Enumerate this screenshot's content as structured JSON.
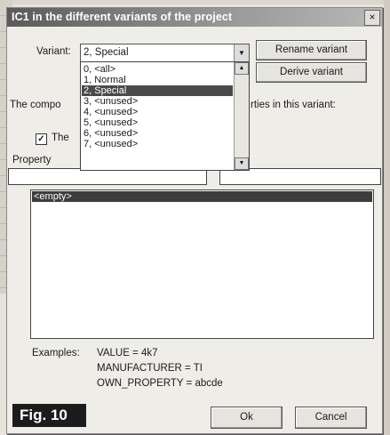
{
  "dialog": {
    "title": "IC1 in the different variants of the project",
    "close_label": "×"
  },
  "variant": {
    "label": "Variant:",
    "selected": "2, Special",
    "options": [
      "0, <all>",
      "1, Normal",
      "2, Special",
      "3, <unused>",
      "4, <unused>",
      "5, <unused>",
      "6, <unused>",
      "7, <unused>"
    ]
  },
  "buttons": {
    "rename": "Rename variant",
    "derive": "Derive variant",
    "ok": "Ok",
    "cancel": "Cancel"
  },
  "components_text_left": "The compo",
  "components_text_right": "rties in this variant:",
  "checkbox": {
    "mark": "✓",
    "label_partial": "The"
  },
  "property_label": "Property",
  "list": {
    "items": [
      "<empty>"
    ]
  },
  "examples": {
    "label": "Examples:",
    "lines": [
      "VALUE = 4k7",
      "MANUFACTURER = TI",
      "OWN_PROPERTY = abcde"
    ]
  },
  "figure_label": "Fig. 10"
}
